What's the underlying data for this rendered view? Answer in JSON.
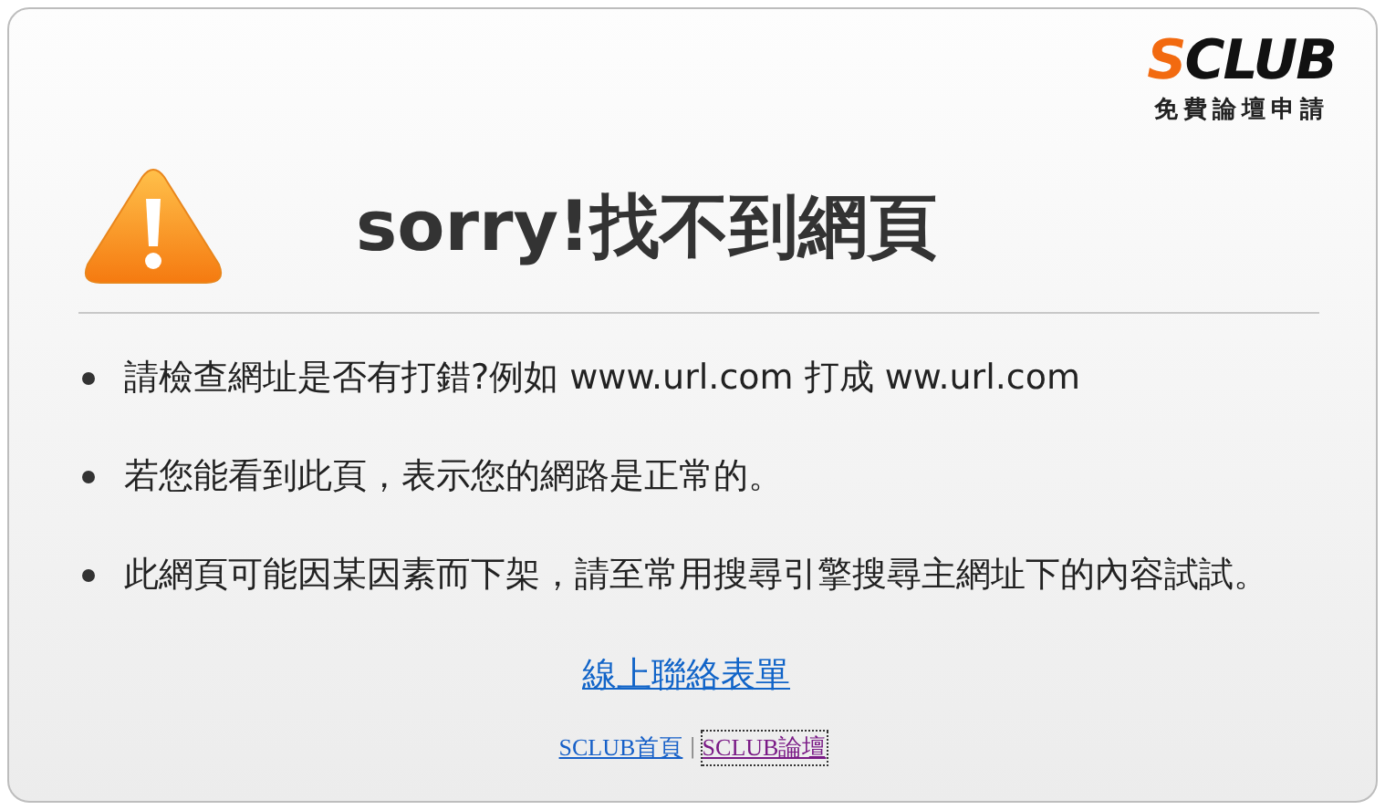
{
  "logo": {
    "accent": "S",
    "rest": "CLUB",
    "tagline": "免費論壇申請"
  },
  "title": "sorry!找不到網頁",
  "bullets": [
    "請檢查網址是否有打錯?例如 www.url.com 打成 ww.url.com",
    "若您能看到此頁，表示您的網路是正常的。",
    "此網頁可能因某因素而下架，請至常用搜尋引擎搜尋主網址下的內容試試。"
  ],
  "contact_link": "線上聯絡表單",
  "footer_links": [
    {
      "label": "SCLUB首頁",
      "visited": false
    },
    {
      "label": "SCLUB論壇",
      "visited": true
    }
  ],
  "footer_separator": "|"
}
